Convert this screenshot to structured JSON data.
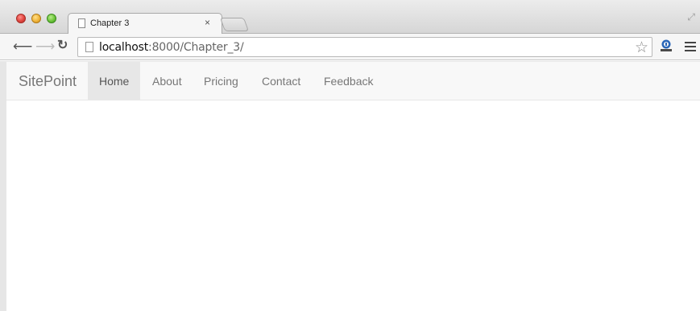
{
  "browser": {
    "tab_title": "Chapter 3",
    "tab_close": "×",
    "url_host": "localhost",
    "url_rest": ":8000/Chapter_3/",
    "icons": {
      "back": "back-arrow-icon",
      "forward": "forward-arrow-icon",
      "reload": "reload-icon",
      "star": "bookmark-star-icon",
      "menu": "hamburger-menu-icon",
      "extension": "extension-icon",
      "fullscreen": "fullscreen-icon"
    }
  },
  "site": {
    "brand": "SitePoint",
    "nav": [
      {
        "label": "Home",
        "active": true
      },
      {
        "label": "About",
        "active": false
      },
      {
        "label": "Pricing",
        "active": false
      },
      {
        "label": "Contact",
        "active": false
      },
      {
        "label": "Feedback",
        "active": false
      }
    ]
  },
  "colors": {
    "navbar_bg": "#f8f8f8",
    "active_bg": "#e7e7e7",
    "nav_text": "#777777"
  }
}
